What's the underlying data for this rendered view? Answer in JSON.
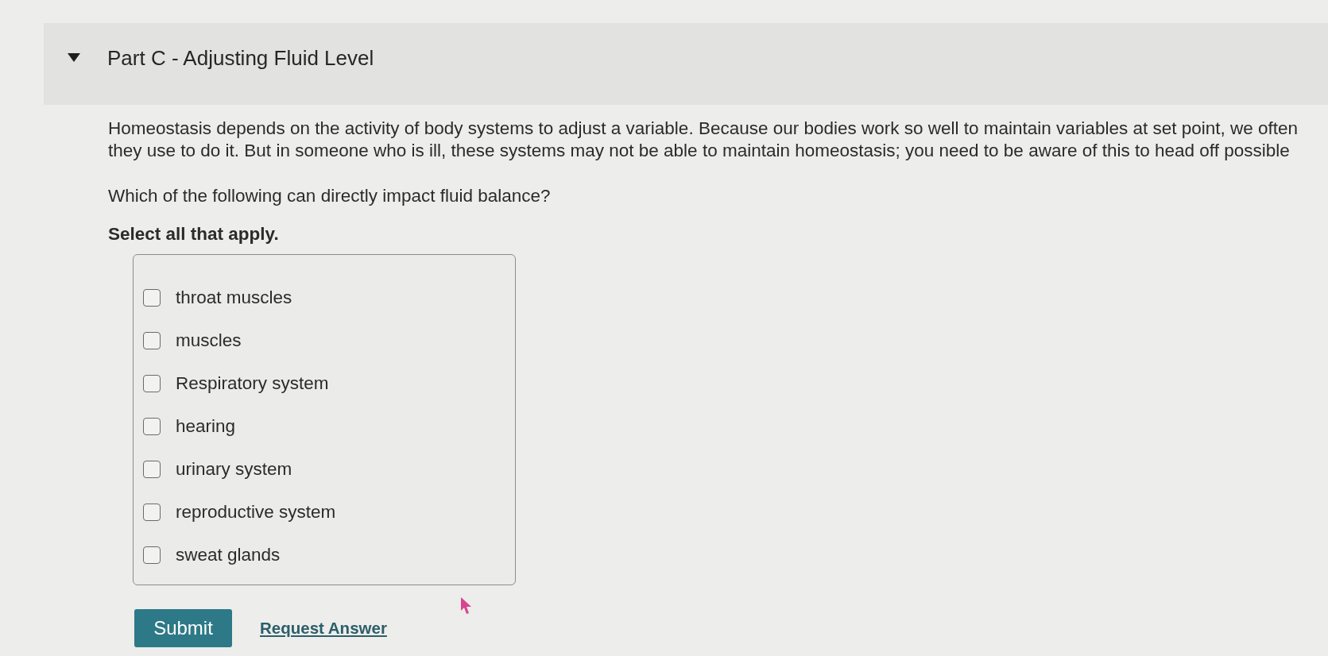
{
  "section": {
    "expanded": true,
    "title": "Part C - Adjusting Fluid Level"
  },
  "intro": {
    "lines": [
      "Homeostasis depends on the activity of body systems to adjust a variable. Because our bodies work so well to maintain variables at set point, we often",
      "they use to do it. But in someone who is ill, these systems may not be able to maintain homeostasis; you need to be aware of this to head off possible"
    ]
  },
  "question": "Which of the following can directly impact fluid balance?",
  "instruction": "Select all that apply.",
  "options": [
    {
      "label": "throat muscles",
      "checked": false
    },
    {
      "label": "muscles",
      "checked": false
    },
    {
      "label": "Respiratory system",
      "checked": false
    },
    {
      "label": "hearing",
      "checked": false
    },
    {
      "label": "urinary system",
      "checked": false
    },
    {
      "label": "reproductive system",
      "checked": false
    },
    {
      "label": "sweat glands",
      "checked": false
    }
  ],
  "buttons": {
    "submit": "Submit",
    "request_answer": "Request Answer"
  }
}
